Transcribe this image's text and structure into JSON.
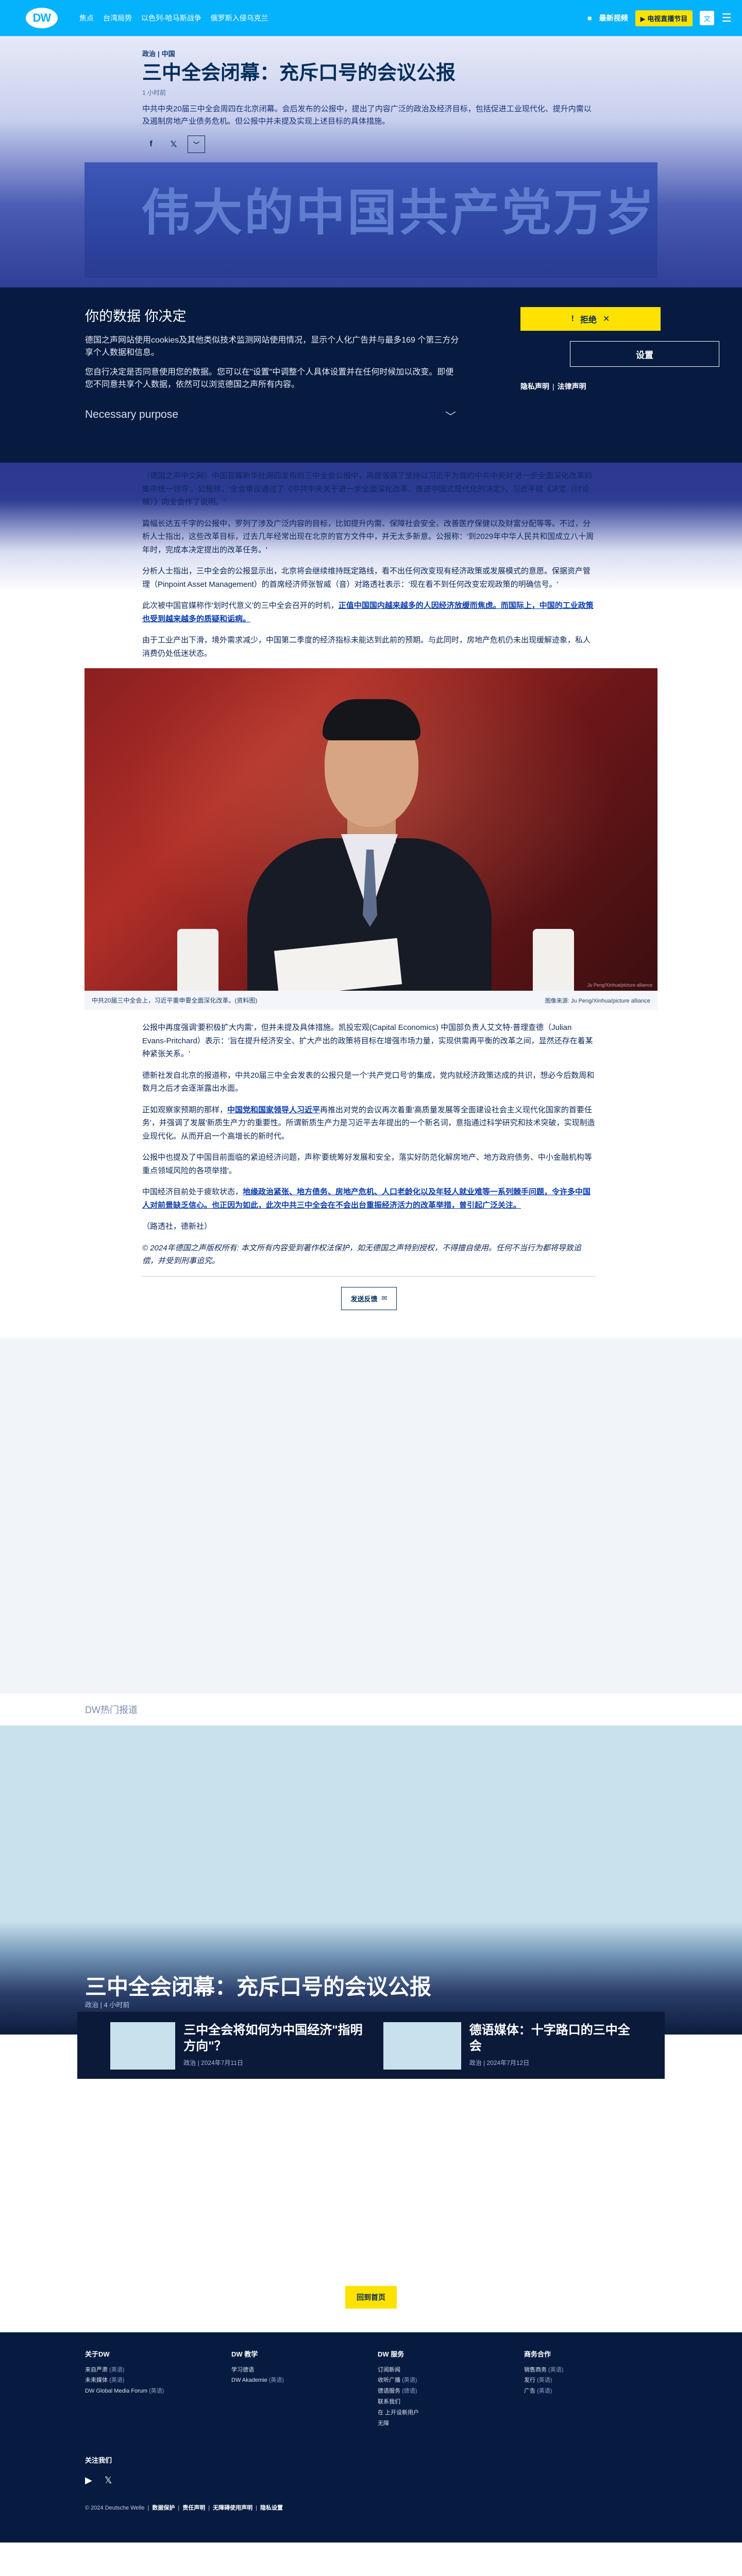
{
  "header": {
    "logo": "DW",
    "nav": [
      "焦点",
      "台湾局势",
      "以色列-哈马斯战争",
      "俄罗斯入侵乌克兰"
    ],
    "latest_icon": "■",
    "latest_label": "最新视频",
    "tv_label": "▶ 电视直播节目",
    "lang_label": "文",
    "menu_icon": "☰"
  },
  "article": {
    "breadcrumb": [
      "政治",
      "中国"
    ],
    "title": "三中全会闭幕：充斥口号的会议公报",
    "time_ago": "1 小时前",
    "teaser": "中共中央20届三中全会周四在北京闭幕。会后发布的公报中，提出了内容广泛的政治及经济目标，包括促进工业现代化、提升内需以及遏制房地产业债务危机。但公报中并未提及实现上述目标的具体措施。",
    "share_icons": [
      "f",
      "𝕏"
    ],
    "collapse_icon": "﹀",
    "hero_sign": "伟大的中国共产党万岁",
    "paragraphs_a": [
      "（德国之声中文网）中国官媒新华社周四发布的三中全会公报中，再度强调了坚持以习近平为首的中共中央对'进一步全面深化改革的集中统一领导'。公报称，'全会审议通过了《中共中央关于进一步全面深化改革、推进中国式现代化的决定》，习近平就《决定（讨论稿）》向全会作了说明。'",
      "篇幅长达五千字的公报中，罗列了涉及广泛内容的目标，比如提升内需、保障社会安全、改善医疗保健以及财富分配等等。不过，分析人士指出，这些改革目标，过去几年经常出现在北京的官方文件中，并无太多新意。公报称：'到2029年中华人民共和国成立八十周年时，完成本决定提出的改革任务。'",
      "分析人士指出，三中全会的公报显示出，北京将会继续维持既定路线，看不出任何改变现有经济政策或发展模式的意愿。保据资产管理（Pinpoint Asset Management）的首席经济师张智威（音）对路透社表示：'现在看不到任何改变宏观政策的明确信号。'"
    ],
    "para_link_pre": "此次被中国官媒称作'划时代意义'的三中全会召开的时机，",
    "para_link_text": "正值中国国内越来越多的人因经济放缓而焦虑。而国际上，中国的工业政策也受到越来越多的质疑和诟病。",
    "para_a_last": "由于工业产出下滑，境外需求减少，中国第二季度的经济指标未能达到此前的预期。与此同时，房地产危机仍未出现缓解迹象，私人消费仍处低迷状态。",
    "caption": "中共20届三中全会上，习近平重申要全面深化改革。(资料图)",
    "photo_credit": "图像来源: Ju Peng/Xinhua/picture alliance",
    "photo_overlay_credit": "Ju Peng/Xinhua/picture alliance",
    "paragraphs_b": [
      "公报中再度强调'要积极扩大内需'，但并未提及具体措施。凯投宏观(Capital Economics) 中国部负责人艾文特-普理查德（Julian Evans-Pritchard）表示：'旨在提升经济安全、扩大产出的政策将目标在增强市场力量，实现供需再平衡的改革之间，显然还存在着某种紧张关系。'",
      "德新社发自北京的报道称，中共20届三中全会发表的公报只是一个'共产党口号'的集成，党内就经济政策达成的共识，想必今后数周和数月之后才会逐渐露出水面。"
    ],
    "para_b3_pre": "正如观察家预期的那样，",
    "para_b3_link": "中国党和国家领导人习近平",
    "para_b3_post": "再推出对党的会议再次着重'高质量发展等全面建设社会主义现代化国家的首要任务'，并强调了发展'新质生产力'的重要性。所谓新质生产力是习近平去年提出的一个新名词，意指通过科学研究和技术突破，实现制造业现代化。从而开启一个高增长的新时代。",
    "para_b4": "公报中也提及了中国目前面临的紧迫经济问题，声称'要统筹好发展和安全，落实好防范化解房地产、地方政府债务、中小金融机构等重点领域风险的各项举措'。",
    "para_b5_pre": "中国经济目前处于疲软状态，",
    "para_b5_link": "地缘政治紧张、地方债务、房地产危机、人口老龄化以及年轻人就业难等一系列棘手问题，令许多中国人对前景缺乏信心。也正因为如此，此次中共三中全会在不会出台重振经济活力的改革举措，曾引起广泛关注。",
    "sources": "（路透社，德新社）",
    "disclaimer": "© 2024年德国之声版权所有: 本文所有内容受到著作权法保护，如无德国之声特别授权，不得擅自使用。任何不当行为都将导致追偿，并受到刑事追究。",
    "feedback_label": "发送反馈",
    "feedback_icon": "✉"
  },
  "consent": {
    "title": "你的数据 你决定",
    "text1": "德国之声网站使用cookies及其他类似技术监测网站使用情况，显示个人化广告并与最多169 个第三方分享个人数据和信息。",
    "text2": "您自行决定是否同意使用您的数据。您可以在\"设置\"中调整个人具体设置并在任何时候加以改变。即便您不同意共享个人数据，依然可以浏览德国之声所有内容。",
    "necessary_label": "Necessary purpose",
    "necessary_icon": "﹀",
    "reject_icon": "!",
    "reject_label": "拒绝",
    "reject_close": "✕",
    "settings_label": "设置",
    "privacy_link": "隐私声明",
    "legal_link": "法律声明"
  },
  "sections": {
    "hot_label": "DW热门报道"
  },
  "dossier": {
    "title": "三中全会闭幕：充斥口号的会议公报",
    "meta": "政治 | 4 小时前",
    "cards": [
      {
        "title": "三中全会将如何为中国经济\"指明方向\"？",
        "meta": "政治 | 2024年7月11日"
      },
      {
        "title": "德语媒体：十字路口的三中全会",
        "meta": "政治 | 2024年7月12日"
      }
    ]
  },
  "back_top_label": "回到首页",
  "footer": {
    "cols": [
      {
        "title": "关于DW",
        "items": [
          [
            "来自严肃",
            "(英语)"
          ],
          [
            "未来媒体",
            "(英语)"
          ],
          [
            "DW Global Media Forum",
            "(英语)"
          ]
        ]
      },
      {
        "title": "DW 教学",
        "items": [
          [
            "学习德语",
            ""
          ],
          [
            "DW Akademie",
            "(英语)"
          ]
        ]
      },
      {
        "title": "DW 服务",
        "items": [
          [
            "订阅新闻",
            ""
          ],
          [
            "收听广播",
            "(英语)"
          ],
          [
            "德语服务",
            "(德语)"
          ],
          [
            "联系我们",
            ""
          ],
          [
            "在 上开设新用户",
            ""
          ],
          [
            "无障",
            ""
          ]
        ]
      },
      {
        "title": "商务合作",
        "items": [
          [
            "销售商务",
            "(英语)"
          ],
          [
            "发行",
            "(英语)"
          ],
          [
            "广告",
            "(英语)"
          ]
        ]
      }
    ],
    "follow_label": "关注我们",
    "social_icons": [
      "▶",
      "𝕏"
    ],
    "legal": [
      "© 2024 Deutsche Welle",
      "数据保护",
      "责任声明",
      "无障碍使用声明",
      "隐私设置"
    ]
  }
}
